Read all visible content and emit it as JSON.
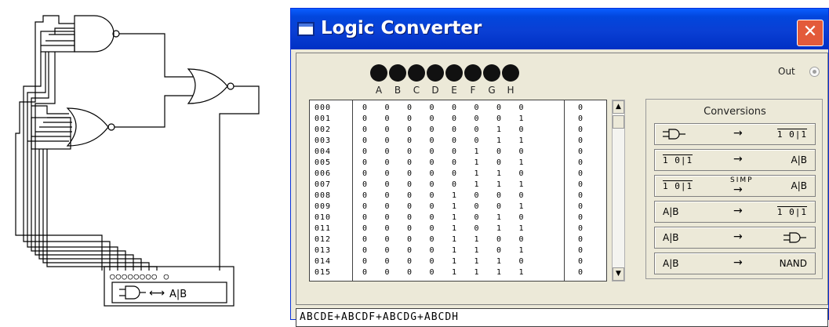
{
  "instrument": {
    "pin_dots": "○○○○○○○○  ○",
    "label": "A|B"
  },
  "window": {
    "title": "Logic Converter",
    "close_glyph": "✕"
  },
  "terminals": [
    "A",
    "B",
    "C",
    "D",
    "E",
    "F",
    "G",
    "H"
  ],
  "out_label": "Out",
  "truth_table": {
    "indexes": [
      "000",
      "001",
      "002",
      "003",
      "004",
      "005",
      "006",
      "007",
      "008",
      "009",
      "010",
      "011",
      "012",
      "013",
      "014",
      "015"
    ],
    "inputs": [
      [
        "0",
        "0",
        "0",
        "0",
        "0",
        "0",
        "0",
        "0"
      ],
      [
        "0",
        "0",
        "0",
        "0",
        "0",
        "0",
        "0",
        "1"
      ],
      [
        "0",
        "0",
        "0",
        "0",
        "0",
        "0",
        "1",
        "0"
      ],
      [
        "0",
        "0",
        "0",
        "0",
        "0",
        "0",
        "1",
        "1"
      ],
      [
        "0",
        "0",
        "0",
        "0",
        "0",
        "1",
        "0",
        "0"
      ],
      [
        "0",
        "0",
        "0",
        "0",
        "0",
        "1",
        "0",
        "1"
      ],
      [
        "0",
        "0",
        "0",
        "0",
        "0",
        "1",
        "1",
        "0"
      ],
      [
        "0",
        "0",
        "0",
        "0",
        "0",
        "1",
        "1",
        "1"
      ],
      [
        "0",
        "0",
        "0",
        "0",
        "1",
        "0",
        "0",
        "0"
      ],
      [
        "0",
        "0",
        "0",
        "0",
        "1",
        "0",
        "0",
        "1"
      ],
      [
        "0",
        "0",
        "0",
        "0",
        "1",
        "0",
        "1",
        "0"
      ],
      [
        "0",
        "0",
        "0",
        "0",
        "1",
        "0",
        "1",
        "1"
      ],
      [
        "0",
        "0",
        "0",
        "0",
        "1",
        "1",
        "0",
        "0"
      ],
      [
        "0",
        "0",
        "0",
        "0",
        "1",
        "1",
        "0",
        "1"
      ],
      [
        "0",
        "0",
        "0",
        "0",
        "1",
        "1",
        "1",
        "0"
      ],
      [
        "0",
        "0",
        "0",
        "0",
        "1",
        "1",
        "1",
        "1"
      ]
    ],
    "outputs": [
      "0",
      "0",
      "0",
      "0",
      "0",
      "0",
      "0",
      "0",
      "0",
      "0",
      "0",
      "0",
      "0",
      "0",
      "0",
      "0"
    ]
  },
  "scrollbar": {
    "up_glyph": "▲",
    "down_glyph": "▼"
  },
  "conversions": {
    "title": "Conversions",
    "arrow": "→",
    "simp_label": "SIMP",
    "buttons": [
      {
        "left": "circuit",
        "right": "10|1"
      },
      {
        "left": "10|1",
        "right": "A|B"
      },
      {
        "left": "10|1",
        "right": "A|B",
        "simp": true
      },
      {
        "left": "A|B",
        "right": "10|1"
      },
      {
        "left": "A|B",
        "right": "circuit"
      },
      {
        "left": "A|B",
        "right": "NAND"
      }
    ],
    "labels": {
      "truth": "1 0|1",
      "bool": "A|B",
      "nand": "NAND"
    }
  },
  "expression": "ABCDE+ABCDF+ABCDG+ABCDH"
}
